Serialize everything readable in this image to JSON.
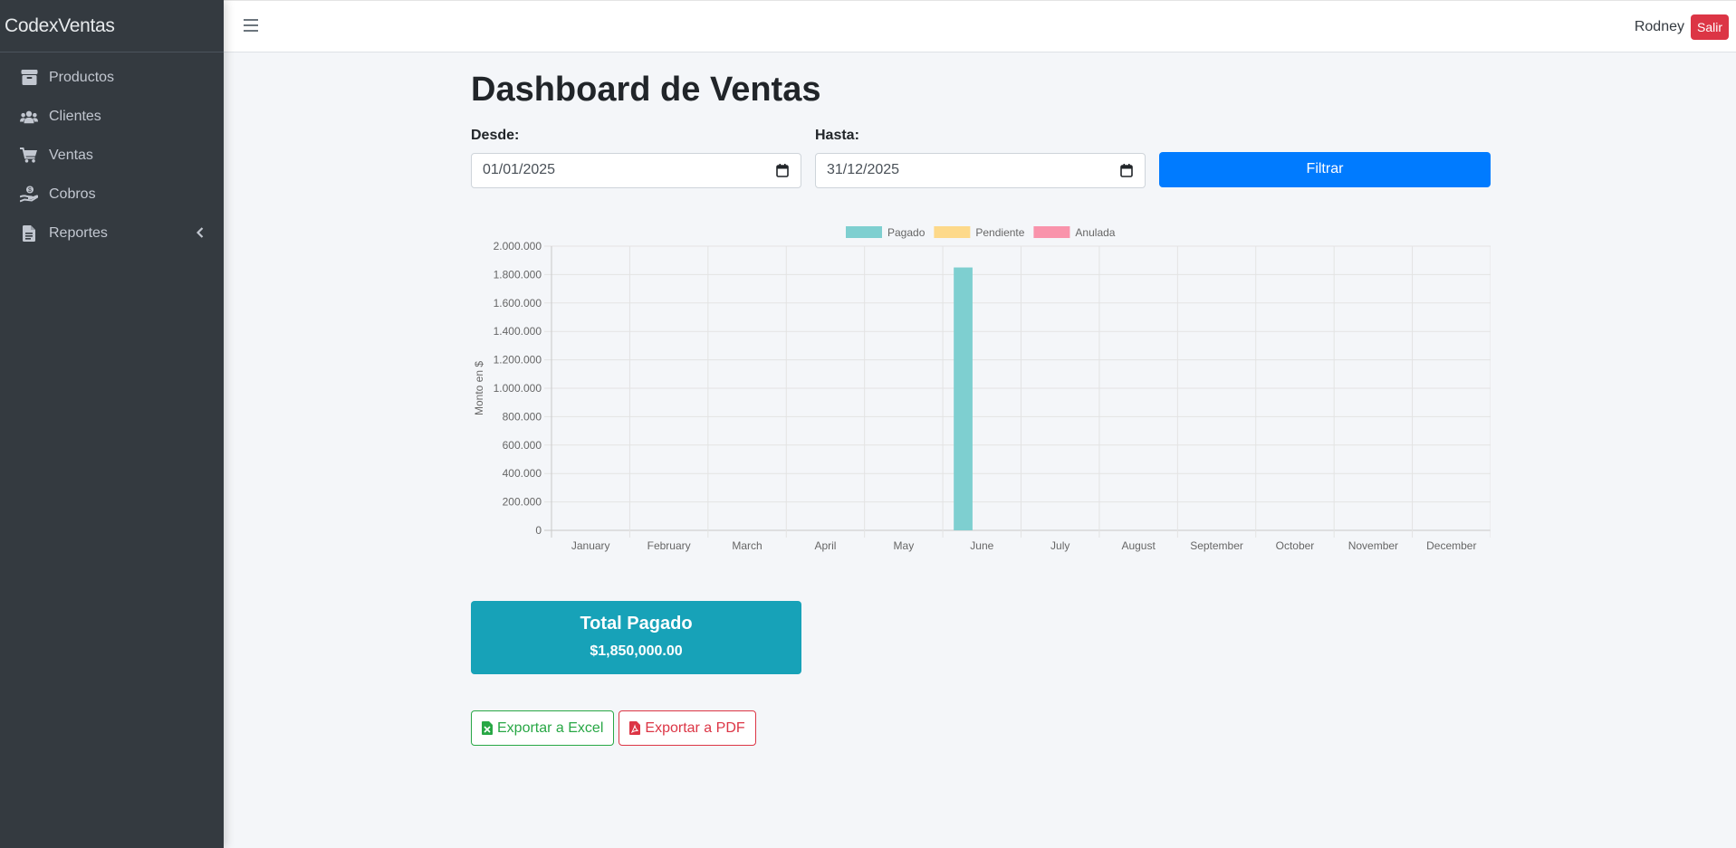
{
  "app": {
    "brand": "CodexVentas"
  },
  "sidebar": {
    "items": [
      {
        "label": "Productos",
        "icon": "box-icon"
      },
      {
        "label": "Clientes",
        "icon": "users-icon"
      },
      {
        "label": "Ventas",
        "icon": "cart-icon"
      },
      {
        "label": "Cobros",
        "icon": "hand-money-icon"
      },
      {
        "label": "Reportes",
        "icon": "file-icon"
      }
    ]
  },
  "header": {
    "user": "Rodney",
    "logout_label": "Salir"
  },
  "page": {
    "title": "Dashboard de Ventas"
  },
  "filters": {
    "from_label": "Desde:",
    "from_value": "01/01/2025",
    "to_label": "Hasta:",
    "to_value": "31/12/2025",
    "button_label": "Filtrar"
  },
  "chart_data": {
    "type": "bar",
    "title": "",
    "xlabel": "",
    "ylabel": "Monto en $",
    "categories": [
      "January",
      "February",
      "March",
      "April",
      "May",
      "June",
      "July",
      "August",
      "September",
      "October",
      "November",
      "December"
    ],
    "series": [
      {
        "name": "Pagado",
        "color": "#7ecfd0",
        "values": [
          0,
          0,
          0,
          0,
          0,
          1850000,
          0,
          0,
          0,
          0,
          0,
          0
        ]
      },
      {
        "name": "Pendiente",
        "color": "#fdd98a",
        "values": [
          0,
          0,
          0,
          0,
          0,
          0,
          0,
          0,
          0,
          0,
          0,
          0
        ]
      },
      {
        "name": "Anulada",
        "color": "#f993ab",
        "values": [
          0,
          0,
          0,
          0,
          0,
          0,
          0,
          0,
          0,
          0,
          0,
          0
        ]
      }
    ],
    "ylim": [
      0,
      2000000
    ],
    "yticks": [
      "0",
      "200.000",
      "400.000",
      "600.000",
      "800.000",
      "1.000.000",
      "1.200.000",
      "1.400.000",
      "1.600.000",
      "1.800.000",
      "2.000.000"
    ],
    "grid": true,
    "legend": "top-center"
  },
  "summary": {
    "label": "Total Pagado",
    "value": "$1,850,000.00"
  },
  "exports": {
    "excel_label": "Exportar a Excel",
    "pdf_label": "Exportar a PDF"
  },
  "colors": {
    "sidebar": "#343a40",
    "primary": "#007bff",
    "info": "#17a2b8",
    "danger": "#dc3545",
    "success": "#28a745"
  }
}
